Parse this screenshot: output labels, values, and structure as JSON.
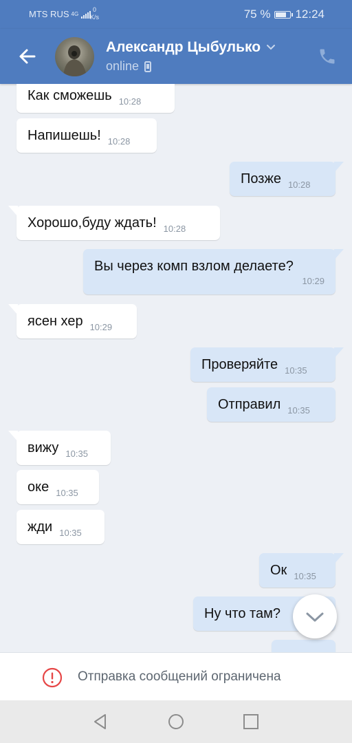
{
  "status_bar": {
    "carrier": "MTS RUS",
    "network": "4G",
    "speed_value": "0",
    "speed_unit": "K/s",
    "battery": "75 %",
    "battery_level": 0.75,
    "time": "12:24"
  },
  "header": {
    "contact_name": "Александр Цыбулько",
    "presence": "online"
  },
  "messages": [
    {
      "dir": "in",
      "text": "Как сможешь",
      "time": "10:28"
    },
    {
      "dir": "in",
      "text": "Напишешь!",
      "time": "10:28"
    },
    {
      "dir": "out",
      "text": "Позже",
      "time": "10:28"
    },
    {
      "dir": "in",
      "text": "Хорошо,буду ждать!",
      "time": "10:28"
    },
    {
      "dir": "out",
      "text": "Вы через комп взлом делаете?",
      "time": "10:29"
    },
    {
      "dir": "in",
      "text": "ясен хер",
      "time": "10:29"
    },
    {
      "dir": "out",
      "text": "Проверяйте",
      "time": "10:35"
    },
    {
      "dir": "out",
      "text": "Отправил",
      "time": "10:35"
    },
    {
      "dir": "in",
      "text": "вижу",
      "time": "10:35"
    },
    {
      "dir": "in",
      "text": "оке",
      "time": "10:35"
    },
    {
      "dir": "in",
      "text": "жди",
      "time": "10:35"
    },
    {
      "dir": "out",
      "text": "Ок",
      "time": "10:35"
    },
    {
      "dir": "out",
      "text": "Ну что там?",
      "time": ""
    }
  ],
  "restriction_notice": "Отправка сообщений ограничена",
  "colors": {
    "header": "#4f7cbf",
    "incoming_bubble": "#ffffff",
    "outgoing_bubble": "#d8e6f7",
    "chat_background": "#edf0f5",
    "warning": "#e64646"
  }
}
